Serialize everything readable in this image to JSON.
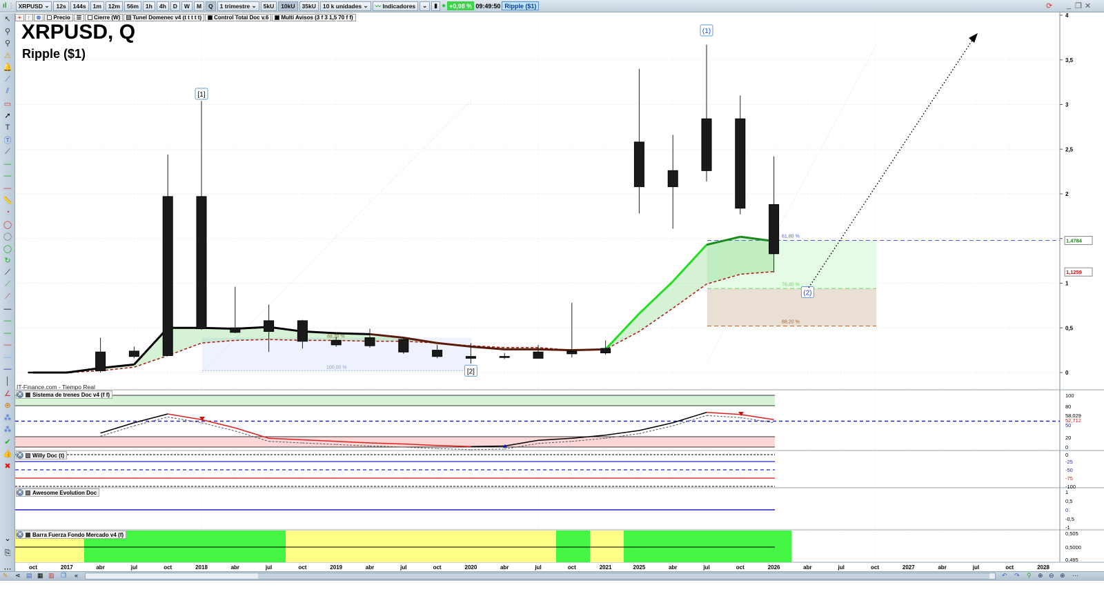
{
  "toolbar": {
    "symbol": "XRPUSD",
    "timeframes": [
      "12s",
      "144s",
      "1m",
      "12m",
      "56m",
      "1h",
      "4h",
      "D",
      "W",
      "M",
      "Q"
    ],
    "active_timeframe": "Q",
    "period": "1 trimestre",
    "units_buttons": [
      "5kU",
      "10kU",
      "35kU"
    ],
    "active_units": "10kU",
    "units_select": "10 k unidades",
    "indicators_label": "Indicadores",
    "change_pct": "+0,98 %",
    "time": "09:49:50",
    "symbol_badge": "Ripple ($1)"
  },
  "legend": {
    "items": [
      "Precio",
      "Cierre (W)",
      "Tunel Domenec v4 (t t t t t)",
      "Control Total Doc v.6",
      "Multi Avisos (3 f 3 1,5 70 f f)"
    ]
  },
  "chart_title": "XRPUSD, Q",
  "chart_subtitle": "Ripple ($1)",
  "source": "IT-Finance.com - Tiempo Real",
  "colors": {
    "bull_trend": "#22dd22",
    "trend": "#000000",
    "support": "#b01010",
    "fib_zone_green": "#e6fbe6",
    "fib_zone_brown": "#eadfd5",
    "bar_green": "#44f544",
    "bar_yellow": "#ffff88"
  },
  "chart_data": {
    "type": "candlestick",
    "ylim": [
      0,
      4
    ],
    "yticks": [
      "0",
      "0,5",
      "1",
      "1,5",
      "2",
      "2,5",
      "3",
      "3,5",
      "4"
    ],
    "price_labels": [
      {
        "value": 1.4784,
        "text": "1,4784",
        "color": "#1a7a1a"
      },
      {
        "value": 1.1259,
        "text": "1,1259",
        "color": "#c01010"
      }
    ],
    "xticks": [
      {
        "t": "oct"
      },
      {
        "t": "2017",
        "b": 1
      },
      {
        "t": "abr"
      },
      {
        "t": "jul"
      },
      {
        "t": "oct"
      },
      {
        "t": "2018",
        "b": 1
      },
      {
        "t": "abr"
      },
      {
        "t": "jul"
      },
      {
        "t": "oct"
      },
      {
        "t": "2019",
        "b": 1
      },
      {
        "t": "abr"
      },
      {
        "t": "jul"
      },
      {
        "t": "oct"
      },
      {
        "t": "2020",
        "b": 1
      },
      {
        "t": "abr"
      },
      {
        "t": "jul"
      },
      {
        "t": "oct"
      },
      {
        "t": "2021",
        "b": 1
      },
      {
        "t": "2025",
        "b": 1
      },
      {
        "t": "abr"
      },
      {
        "t": "jul"
      },
      {
        "t": "oct"
      },
      {
        "t": "2026",
        "b": 1
      },
      {
        "t": "abr"
      },
      {
        "t": "jul"
      },
      {
        "t": "oct"
      },
      {
        "t": "2027",
        "b": 1
      },
      {
        "t": "abr"
      },
      {
        "t": "jul"
      },
      {
        "t": "oct"
      },
      {
        "t": "2028",
        "b": 1
      }
    ],
    "candles": [
      [
        0.006,
        0.007,
        0.005,
        0.006
      ],
      [
        0.007,
        0.01,
        0.006,
        0.008
      ],
      [
        0.02,
        0.39,
        0.0,
        0.23
      ],
      [
        0.18,
        0.29,
        0.16,
        0.24
      ],
      [
        0.19,
        2.44,
        0.19,
        1.97
      ],
      [
        1.97,
        3.04,
        0.48,
        0.49
      ],
      [
        0.5,
        0.96,
        0.44,
        0.45
      ],
      [
        0.46,
        0.76,
        0.23,
        0.58
      ],
      [
        0.58,
        0.59,
        0.27,
        0.35
      ],
      [
        0.36,
        0.4,
        0.29,
        0.31
      ],
      [
        0.3,
        0.49,
        0.28,
        0.39
      ],
      [
        0.37,
        0.4,
        0.21,
        0.23
      ],
      [
        0.25,
        0.31,
        0.16,
        0.18
      ],
      [
        0.18,
        0.33,
        0.1,
        0.16
      ],
      [
        0.17,
        0.22,
        0.15,
        0.18
      ],
      [
        0.16,
        0.31,
        0.16,
        0.23
      ],
      [
        0.24,
        0.78,
        0.17,
        0.21
      ],
      [
        0.22,
        0.36,
        0.2,
        0.27
      ],
      [
        2.08,
        3.4,
        1.78,
        2.58
      ],
      [
        2.08,
        2.66,
        1.61,
        2.26
      ],
      [
        2.26,
        3.67,
        2.14,
        2.84
      ],
      [
        2.84,
        3.1,
        1.77,
        1.84
      ],
      [
        1.88,
        2.42,
        1.12,
        1.33
      ]
    ],
    "trend": [
      0.0,
      0.0,
      0.05,
      0.09,
      0.5,
      0.5,
      0.49,
      0.51,
      0.46,
      0.44,
      0.43,
      0.39,
      0.33,
      0.29,
      0.26,
      0.26,
      0.25,
      0.26,
      0.66,
      1.02,
      1.43,
      1.52,
      1.47
    ],
    "support": [
      0.0,
      0.0,
      0.02,
      0.06,
      0.19,
      0.33,
      0.36,
      0.37,
      0.36,
      0.36,
      0.35,
      0.35,
      0.33,
      0.3,
      0.28,
      0.28,
      0.25,
      0.26,
      0.46,
      0.72,
      0.99,
      1.1,
      1.13
    ],
    "fib": [
      {
        "label": "61,80 %",
        "value": 1.4784,
        "color": "#5060e0"
      },
      {
        "label": "76,40 %",
        "value": 0.94,
        "color": "#60dd60"
      },
      {
        "label": "88,20 %",
        "value": 0.52,
        "color": "#b06020"
      }
    ],
    "fib_left": [
      {
        "label": "88,20 %",
        "value": 0.39,
        "color": "#906030"
      },
      {
        "label": "100,00 %",
        "value": 0.02,
        "color": "#8aa0d0"
      }
    ],
    "markers": [
      {
        "label": "[1]",
        "index": 5,
        "value": 3.12
      },
      {
        "label": "[2]",
        "index": 13,
        "value": 0.02
      },
      {
        "label": "(1)",
        "index": 20,
        "value": 3.83
      },
      {
        "label": "(2)",
        "index": 23,
        "value": 0.9
      }
    ]
  },
  "panels": [
    {
      "title": "Sistema de trenes Doc v4 (f f)",
      "ticks": [
        "100",
        "80",
        "58,029",
        "52,712",
        "50",
        "20",
        "0"
      ],
      "values": [
        null,
        null,
        27,
        47,
        64,
        53,
        37,
        17,
        14,
        11,
        8,
        6,
        3,
        1,
        2,
        13,
        17,
        23,
        32,
        47,
        67,
        63,
        53
      ]
    },
    {
      "title": "Willy Doc (t)",
      "ticks": [
        "0",
        "-25",
        "-50",
        "-75",
        "-100"
      ]
    },
    {
      "title": "Awesome Evolution Doc",
      "ticks": [
        "1",
        "0,5",
        "0",
        "-0,5",
        "-1"
      ]
    },
    {
      "title": "Barra Fuerza Fondo Mercado v4 (f)",
      "ticks": [
        "0,505",
        "0,5000",
        "0,495"
      ],
      "bands": [
        "yellow",
        "green",
        "yellow",
        "green",
        "yellow",
        "green"
      ]
    }
  ]
}
